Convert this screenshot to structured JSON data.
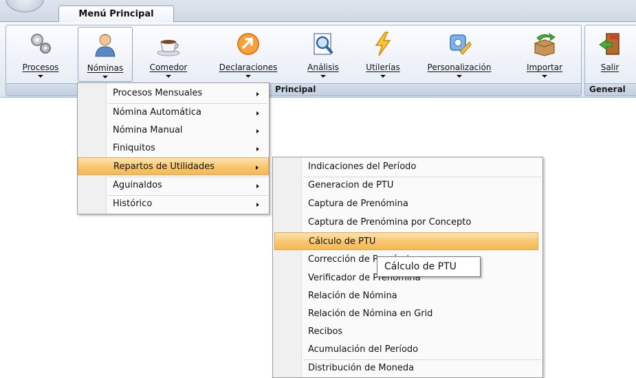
{
  "tab": {
    "main_label": "Menú Principal"
  },
  "ribbon": {
    "buttons": [
      {
        "label": "Procesos",
        "icon": "gears-icon"
      },
      {
        "label": "Nóminas",
        "icon": "user-icon"
      },
      {
        "label": "Comedor",
        "icon": "coffee-cup-icon"
      },
      {
        "label": "Declaraciones",
        "icon": "orange-arrow-circle-icon"
      },
      {
        "label": "Análisis",
        "icon": "magnifier-chart-icon"
      },
      {
        "label": "Utilerías",
        "icon": "lightning-icon"
      },
      {
        "label": "Personalización",
        "icon": "settings-tools-icon"
      },
      {
        "label": "Importar",
        "icon": "import-box-icon"
      },
      {
        "label": "Salir",
        "icon": "exit-door-icon"
      }
    ],
    "group1_label": "Principal",
    "group2_label": "General"
  },
  "nominas_menu": {
    "items": [
      {
        "label": "Procesos Mensuales"
      },
      {
        "label": "Nómina Automática"
      },
      {
        "label": "Nómina Manual"
      },
      {
        "label": "Finiquitos"
      },
      {
        "label": "Repartos de Utilidades"
      },
      {
        "label": "Aguinaldos"
      },
      {
        "label": "Histórico"
      }
    ]
  },
  "utilidades_menu": {
    "items": [
      {
        "label": "Indicaciones del Período"
      },
      {
        "label": "Generacion de PTU"
      },
      {
        "label": "Captura de Prenómina"
      },
      {
        "label": "Captura de Prenómina por Concepto"
      },
      {
        "label": "Cálculo de PTU"
      },
      {
        "label": "Corrección de Prenómina"
      },
      {
        "label": "Verificador de Prenómina"
      },
      {
        "label": "Relación de Nómina"
      },
      {
        "label": "Relación de Nómina en Grid"
      },
      {
        "label": "Recibos"
      },
      {
        "label": "Acumulación del Período"
      },
      {
        "label": "Distribución de Moneda"
      }
    ]
  },
  "tooltip": {
    "text": "Cálculo de PTU"
  },
  "colors": {
    "highlight": "#f8c66c",
    "ribbon_border": "#8ea4c0"
  }
}
